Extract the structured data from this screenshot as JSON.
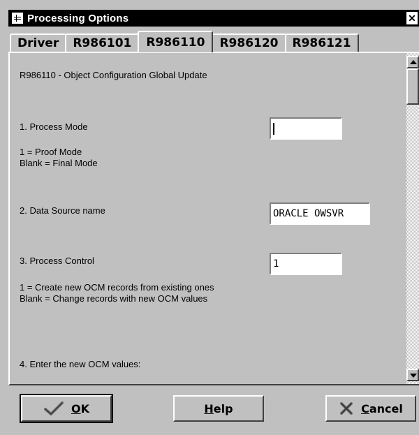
{
  "window": {
    "title": "Processing Options",
    "close_glyph": "✕"
  },
  "tabs": [
    {
      "label": "Driver",
      "active": false
    },
    {
      "label": "R986101",
      "active": false
    },
    {
      "label": "R986110",
      "active": true
    },
    {
      "label": "R986120",
      "active": false
    },
    {
      "label": "R986121",
      "active": false
    }
  ],
  "form": {
    "heading": "R986110 - Object Configuration Global Update",
    "q1": {
      "label": "1.  Process Mode",
      "value": "",
      "help1": "1 = Proof Mode",
      "help2": "Blank = Final Mode"
    },
    "q2": {
      "label": "2.  Data Source name",
      "value": "ORACLE OWSVR"
    },
    "q3": {
      "label": "3.  Process Control",
      "value": "1",
      "help1": "1 = Create new OCM records from existing ones",
      "help2": "Blank = Change records with new OCM values"
    },
    "q4": {
      "label": "4.  Enter the new OCM values:"
    }
  },
  "buttons": {
    "ok": {
      "prefix": "",
      "mnemonic": "O",
      "rest": "K",
      "icon": "checkmark-icon"
    },
    "help": {
      "prefix": "",
      "mnemonic": "H",
      "rest": "elp"
    },
    "cancel": {
      "prefix": "",
      "mnemonic": "C",
      "rest": "ancel",
      "icon": "x-icon"
    }
  }
}
